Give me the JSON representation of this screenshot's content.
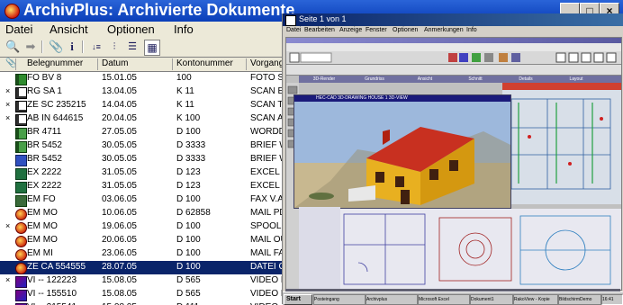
{
  "main": {
    "title": "ArchivPlus: Archivierte Dokumente",
    "menu": [
      "Datei",
      "Ansicht",
      "Optionen",
      "Info"
    ],
    "toolbar_icons": [
      "binoculars-icon",
      "arrow-right-icon",
      "clip-icon",
      "info-icon",
      "sort-icon",
      "tree-icon",
      "grid-icon"
    ],
    "columns": [
      "Belegnummer",
      "Datum",
      "Kontonummer",
      "Vorgang"
    ],
    "rows": [
      {
        "mark": "",
        "icon": "ic-doc",
        "beleg": "FO BV 8",
        "datum": "15.01.05",
        "konto": "100",
        "vorgang": "FOTO SC"
      },
      {
        "mark": "×",
        "icon": "ic-scan",
        "beleg": "RG SA 1",
        "datum": "13.04.05",
        "konto": "K 11",
        "vorgang": "SCAN E-"
      },
      {
        "mark": "×",
        "icon": "ic-scan",
        "beleg": "ZE SC 235215",
        "datum": "14.04.05",
        "konto": "K 11",
        "vorgang": "SCAN TE"
      },
      {
        "mark": "×",
        "icon": "ic-scan",
        "beleg": "AB IN 644615",
        "datum": "20.04.05",
        "konto": "K 100",
        "vorgang": "SCAN AU"
      },
      {
        "mark": "",
        "icon": "ic-doc2",
        "beleg": "BR 4711",
        "datum": "27.05.05",
        "konto": "D 100",
        "vorgang": "WORDD"
      },
      {
        "mark": "",
        "icon": "ic-doc2",
        "beleg": "BR 5452",
        "datum": "30.05.05",
        "konto": "D 3333",
        "vorgang": "BRIEF W"
      },
      {
        "mark": "",
        "icon": "ic-word",
        "beleg": "BR 5452",
        "datum": "30.05.05",
        "konto": "D 3333",
        "vorgang": "BRIEF W"
      },
      {
        "mark": "",
        "icon": "ic-excel",
        "beleg": "EX 2222",
        "datum": "31.05.05",
        "konto": "D 123",
        "vorgang": "EXCEL K"
      },
      {
        "mark": "",
        "icon": "ic-excel",
        "beleg": "EX 2222",
        "datum": "31.05.05",
        "konto": "D 123",
        "vorgang": "EXCEL K"
      },
      {
        "mark": "",
        "icon": "ic-fax",
        "beleg": "EM FO",
        "datum": "03.06.05",
        "konto": "D 100",
        "vorgang": "FAX V.AS"
      },
      {
        "mark": "",
        "icon": "ic-mail",
        "beleg": "EM MO",
        "datum": "10.06.05",
        "konto": "D 62858",
        "vorgang": "MAIL PD"
      },
      {
        "mark": "×",
        "icon": "ic-mail",
        "beleg": "EM MO",
        "datum": "19.06.05",
        "konto": "D 100",
        "vorgang": "SPOOLD"
      },
      {
        "mark": "",
        "icon": "ic-mail",
        "beleg": "EM MO",
        "datum": "20.06.05",
        "konto": "D 100",
        "vorgang": "MAIL OU"
      },
      {
        "mark": "",
        "icon": "ic-mail",
        "beleg": "EM MI",
        "datum": "23.06.05",
        "konto": "D 100",
        "vorgang": "MAIL FAX"
      },
      {
        "mark": "",
        "icon": "ic-mail",
        "beleg": "ZE CA 554555",
        "datum": "28.07.05",
        "konto": "D 100",
        "vorgang": "DATEI C",
        "selected": true
      },
      {
        "mark": "×",
        "icon": "ic-video",
        "beleg": "VI -- 122223",
        "datum": "15.08.05",
        "konto": "D 565",
        "vorgang": "VIDEO B"
      },
      {
        "mark": "",
        "icon": "ic-video",
        "beleg": "VI -- 155510",
        "datum": "15.08.05",
        "konto": "D 565",
        "vorgang": "VIDEO B"
      },
      {
        "mark": "",
        "icon": "ic-video",
        "beleg": "VI -- 215541",
        "datum": "15.08.05",
        "konto": "D 111",
        "vorgang": "VIDEO"
      }
    ]
  },
  "viewer": {
    "title": "Seite 1 von 1",
    "menu": [
      "Datei",
      "Bearbeiten",
      "Anzeige",
      "Fenster",
      "Optionen",
      "Anmerkungen",
      "Info"
    ],
    "house_window_title": "HEC-CAD 3D-DRAWING  HOUSE 1  3D-VIEW",
    "tabs": [
      "3D-Render",
      "Grundriss",
      "Ansicht",
      "Schnitt",
      "Details",
      "Layout"
    ],
    "taskbar": {
      "start": "Start",
      "buttons": [
        "Posteingang",
        "Archivplus",
        "Microsoft Excel",
        "Dokument1",
        "RakoView - Kopie",
        "BildschirmDemo"
      ],
      "clock": "16:41"
    }
  },
  "window_controls": [
    "_",
    "□",
    "×"
  ]
}
